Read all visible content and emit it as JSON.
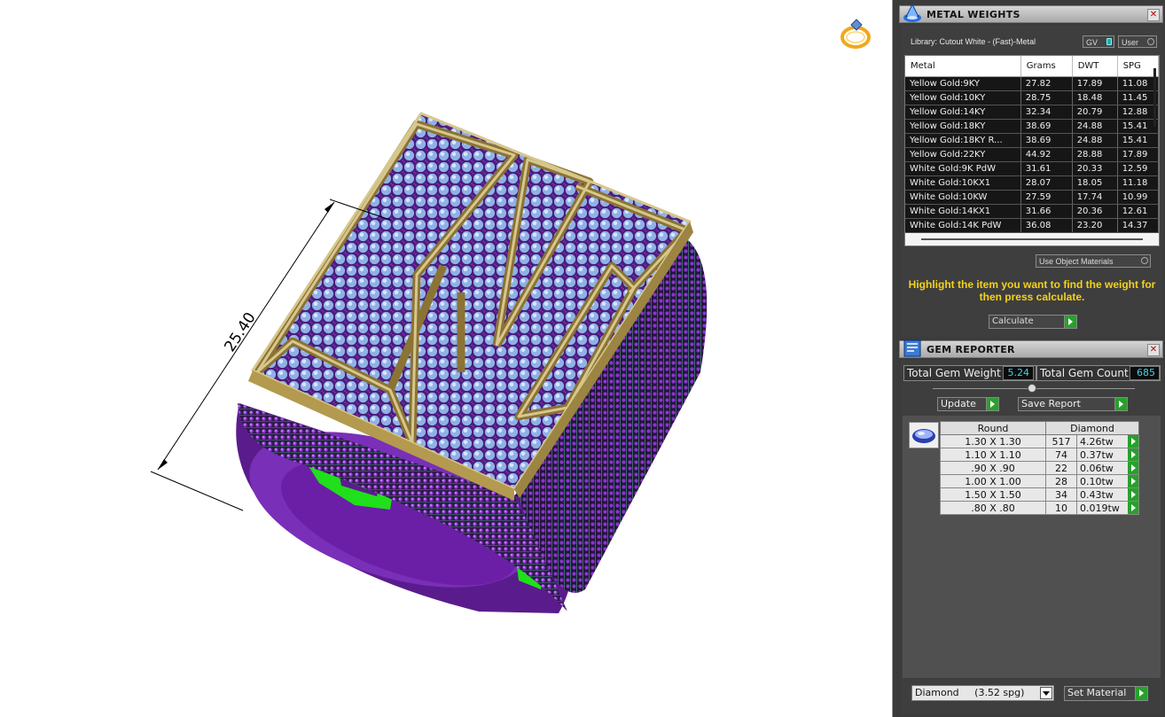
{
  "viewport": {
    "dimension_label": "25.40",
    "model": "ring"
  },
  "metal_weights": {
    "title": "METAL WEIGHTS",
    "library": "Library: Cutout White - (Fast)-Metal",
    "toggle_gv": "GV",
    "toggle_user": "User",
    "columns": [
      "Metal",
      "Grams",
      "DWT",
      "SPG"
    ],
    "rows": [
      [
        "Yellow Gold:9KY",
        "27.82",
        "17.89",
        "11.08"
      ],
      [
        "Yellow Gold:10KY",
        "28.75",
        "18.48",
        "11.45"
      ],
      [
        "Yellow Gold:14KY",
        "32.34",
        "20.79",
        "12.88"
      ],
      [
        "Yellow Gold:18KY",
        "38.69",
        "24.88",
        "15.41"
      ],
      [
        "Yellow Gold:18KY R...",
        "38.69",
        "24.88",
        "15.41"
      ],
      [
        "Yellow Gold:22KY",
        "44.92",
        "28.88",
        "17.89"
      ],
      [
        "White Gold:9K PdW",
        "31.61",
        "20.33",
        "12.59"
      ],
      [
        "White Gold:10KX1",
        "28.07",
        "18.05",
        "11.18"
      ],
      [
        "White Gold:10KW",
        "27.59",
        "17.74",
        "10.99"
      ],
      [
        "White Gold:14KX1",
        "31.66",
        "20.36",
        "12.61"
      ],
      [
        "White Gold:14K PdW",
        "36.08",
        "23.20",
        "14.37"
      ]
    ],
    "use_object_materials": "Use Object Materials",
    "hint": "Highlight the item you want to find the weight for then press calculate.",
    "calculate": "Calculate"
  },
  "gem_reporter": {
    "title": "GEM REPORTER",
    "total_weight_label": "Total Gem Weight",
    "total_weight_value": "5.24",
    "total_count_label": "Total Gem Count",
    "total_count_value": "685",
    "update": "Update",
    "save_report": "Save Report",
    "columns": [
      "Round",
      "Diamond"
    ],
    "rows": [
      [
        "1.30 X 1.30",
        "517",
        "4.26tw"
      ],
      [
        "1.10 X 1.10",
        "74",
        "0.37tw"
      ],
      [
        ".90 X .90",
        "22",
        "0.06tw"
      ],
      [
        "1.00 X 1.00",
        "28",
        "0.10tw"
      ],
      [
        "1.50 X 1.50",
        "34",
        "0.43tw"
      ],
      [
        ".80 X .80",
        "10",
        "0.019tw"
      ]
    ],
    "material": "Diamond     (3.52 spg)",
    "set_material": "Set Material"
  }
}
